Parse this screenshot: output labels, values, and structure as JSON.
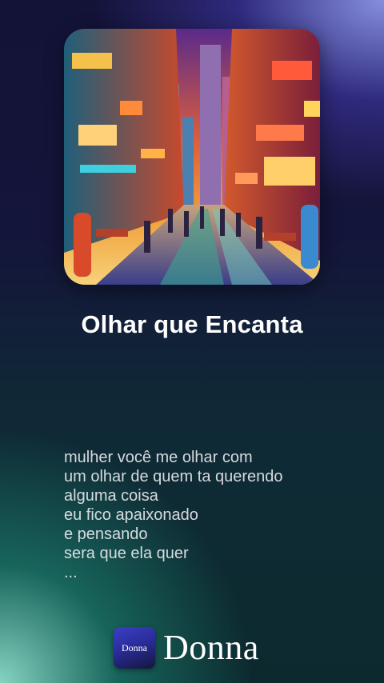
{
  "song": {
    "title": "Olhar que Encanta",
    "lyrics": [
      "mulher você me olhar com",
      "um olhar de quem ta querendo",
      "alguma coisa",
      "eu fico apaixonado",
      "e pensando",
      "sera que ela quer",
      "..."
    ]
  },
  "brand": {
    "logo_text": "Donna",
    "name": "Donna"
  }
}
